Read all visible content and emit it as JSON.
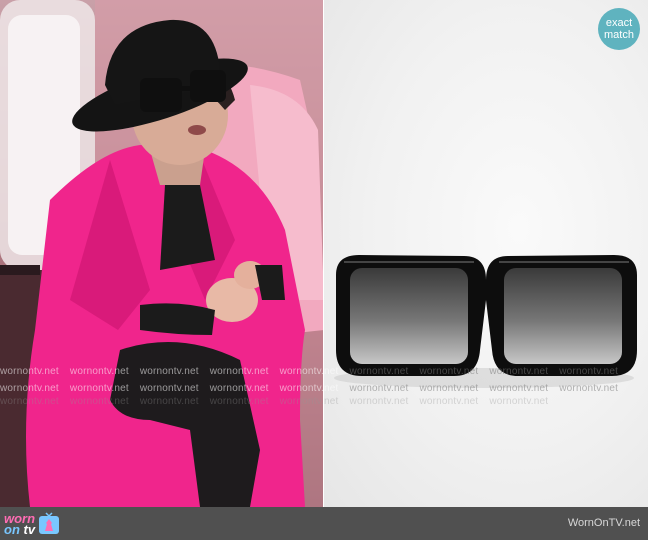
{
  "watermark": {
    "text": "wornontv.net",
    "right_text": "wornontv.net"
  },
  "badge": {
    "line1": "exact",
    "line2": "match"
  },
  "logo": {
    "line1": "worn",
    "line2_prefix": "on ",
    "line2_suffix": "tv"
  },
  "footer": {
    "site": "WornOnTV.net"
  },
  "colors": {
    "coat": "#f0258c",
    "hat": "#141414",
    "bar": "#505050",
    "badge": "#5fb3bf",
    "logo_pink": "#ff6db4",
    "logo_blue": "#79c7ff"
  },
  "icons": {
    "logo_mark": "tv-dress-icon"
  }
}
